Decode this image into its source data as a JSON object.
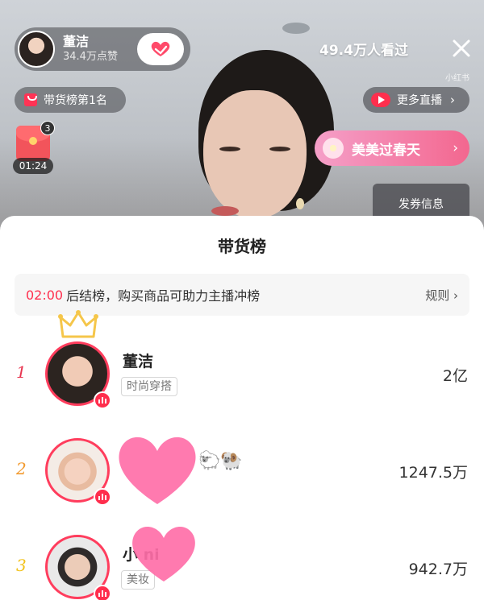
{
  "host": {
    "name": "董洁",
    "likes": "34.4万点赞",
    "viewers": "49.4万人看过",
    "rank_badge": "带货榜第1名"
  },
  "watermark": "小红书",
  "more_live": "更多直播",
  "red_packet": {
    "count": "3",
    "timer": "01:24"
  },
  "event": {
    "label": "美美过春天"
  },
  "coupon": {
    "label": "发券信息"
  },
  "sheet": {
    "title": "带货榜",
    "notice_countdown": "02:00",
    "notice_text": "后结榜，购买商品可助力主播冲榜",
    "rules_label": "规则"
  },
  "ranking": [
    {
      "rank": "1",
      "name": "董洁",
      "tag": "时尚穿搭",
      "value": "2亿"
    },
    {
      "rank": "2",
      "name": "",
      "tag": "",
      "value": "1247.5万"
    },
    {
      "rank": "3",
      "name": "小            ni",
      "tag": "美妆",
      "value": "942.7万"
    }
  ],
  "colors": {
    "accent": "#ff2e4d",
    "rank1": "#e8344f",
    "rank2": "#f29a2e",
    "rank3": "#f2c21b",
    "event_start": "#f59fc8",
    "event_end": "#f3678f"
  },
  "icons": {
    "close": "close-icon",
    "follow": "heart-follow-icon",
    "bag": "shopping-bag-icon",
    "play": "play-icon",
    "flower": "flower-icon",
    "crown": "crown-icon",
    "live": "live-bars-icon"
  }
}
